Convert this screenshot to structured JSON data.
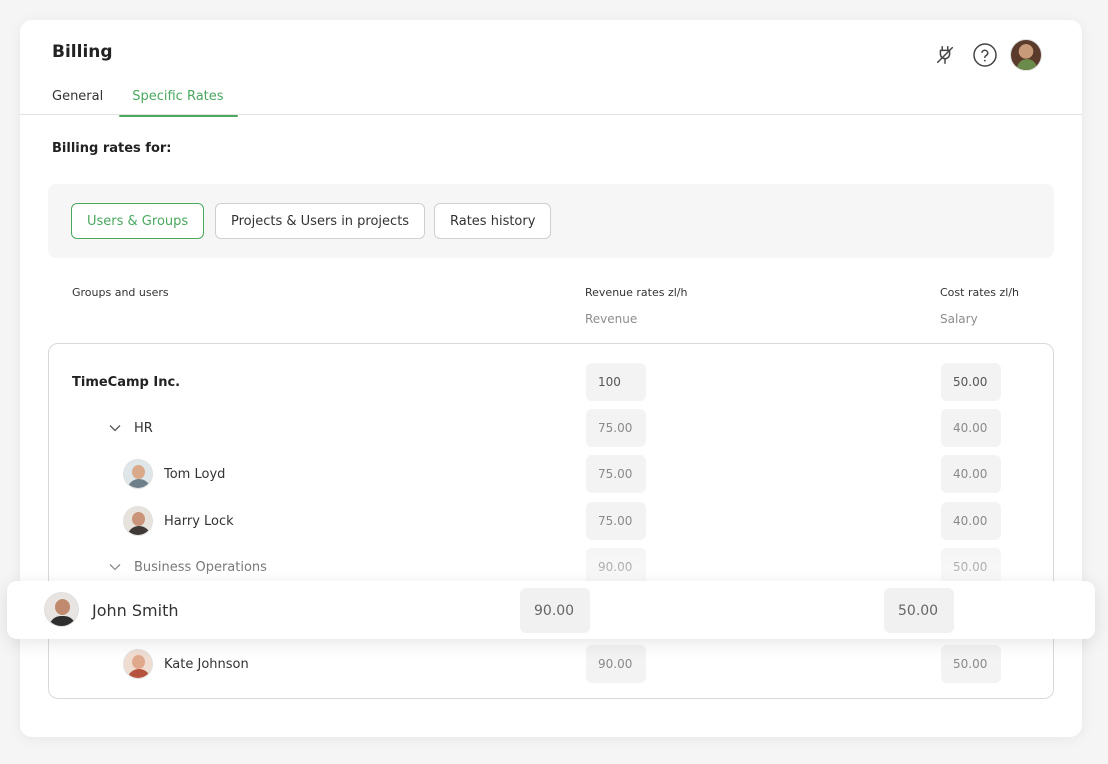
{
  "header": {
    "title": "Billing",
    "tabs": [
      {
        "label": "General",
        "active": false
      },
      {
        "label": "Specific Rates",
        "active": true
      }
    ],
    "icons": [
      "plug-icon",
      "help-icon",
      "user-avatar"
    ]
  },
  "billing_rates_label": "Billing rates for:",
  "filters": [
    {
      "label": "Users & Groups",
      "active": true
    },
    {
      "label": "Projects & Users in projects",
      "active": false
    },
    {
      "label": "Rates history",
      "active": false
    }
  ],
  "columns": {
    "name": "Groups and users",
    "revenue": "Revenue rates zl/h",
    "revenue_sub": "Revenue",
    "cost": "Cost rates zl/h",
    "cost_sub": "Salary"
  },
  "rows": [
    {
      "name": "TimeCamp Inc.",
      "type": "org",
      "revenue": "100",
      "cost": "50.00"
    },
    {
      "name": "HR",
      "type": "group",
      "revenue": "75.00",
      "cost": "40.00"
    },
    {
      "name": "Tom Loyd",
      "type": "user",
      "revenue": "75.00",
      "cost": "40.00"
    },
    {
      "name": "Harry Lock",
      "type": "user",
      "revenue": "75.00",
      "cost": "40.00"
    },
    {
      "name": "Business Operations",
      "type": "group",
      "revenue": "90.00",
      "cost": "50.00"
    },
    {
      "name": "Kate Johnson",
      "type": "user",
      "revenue": "90.00",
      "cost": "50.00"
    }
  ],
  "highlighted_row": {
    "name": "John Smith",
    "revenue": "90.00",
    "cost": "50.00"
  },
  "colors": {
    "accent": "#4aa85f",
    "text": "#2b2b2b",
    "muted": "#8d8d8d"
  }
}
